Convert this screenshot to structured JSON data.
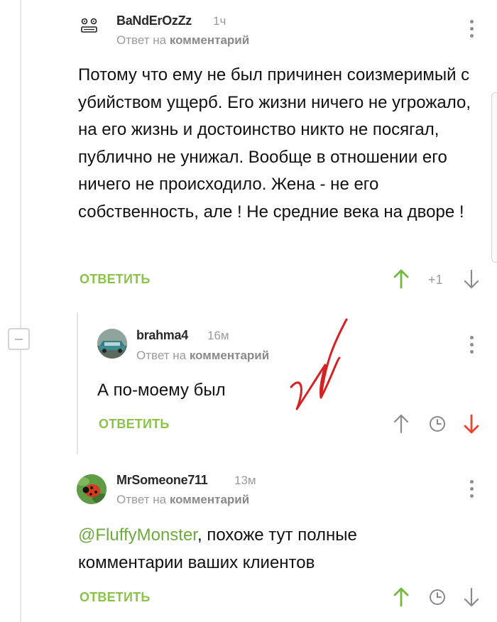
{
  "comments": [
    {
      "author": "BaNdErOzZz",
      "time": "1ч",
      "reply_prefix": "Ответ на ",
      "reply_link": "комментарий",
      "body": "Потому что ему не был причинен соизмеримый с убийством ущерб. Его жизни ничего не угрожало, на его жизнь и достоинство никто не посягал, публично не унижал. Вообще в отношении его ничего не происходило. Жена - не его собственность, але ! Не средние века на дворе !",
      "reply_label": "ОТВЕТИТЬ",
      "score": "+1"
    },
    {
      "author": "brahma4",
      "time": "16м",
      "reply_prefix": "Ответ на ",
      "reply_link": "комментарий",
      "body": "А по-моему был",
      "reply_label": "ОТВЕТИТЬ"
    },
    {
      "author": "MrSomeone711",
      "time": "13м",
      "reply_prefix": "Ответ на ",
      "reply_link": "комментарий",
      "mention": "@FluffyMonster",
      "body": ", похоже тут полные комментарии ваших клиентов",
      "reply_label": "ОТВЕТИТЬ"
    }
  ],
  "colors": {
    "accent_green": "#8bc34a",
    "upvoted": "#74b93f",
    "downvoted": "#e8452c",
    "muted": "#9b9b9b",
    "annotation": "#d62222"
  }
}
